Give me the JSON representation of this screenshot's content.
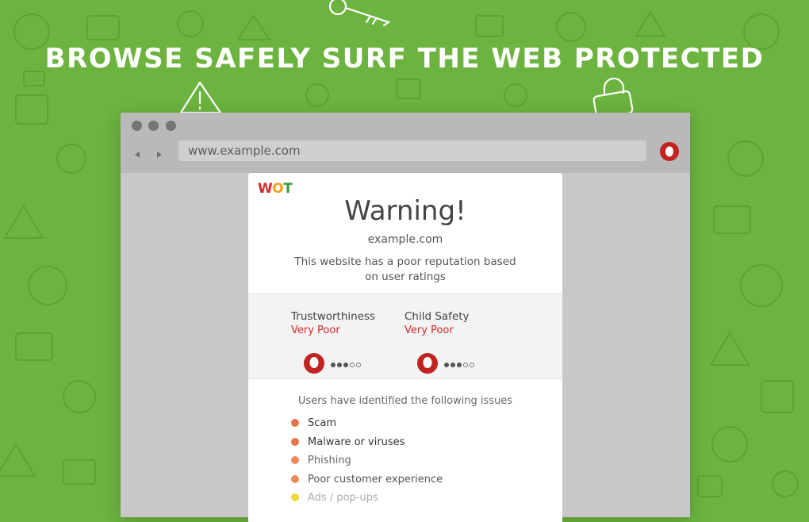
{
  "banner": {
    "headline": "BROWSE SAFELY SURF THE WEB PROTECTED"
  },
  "browser": {
    "address": "www.example.com",
    "nav_back_icon": "triangle-left-icon",
    "nav_forward_icon": "triangle-right-icon",
    "extension_icon": "wot-ring-icon"
  },
  "warning": {
    "logo": {
      "w": "W",
      "o": "O",
      "t": "T"
    },
    "title": "Warning!",
    "domain": "example.com",
    "description": "This website has a poor reputation based on user ratings",
    "ratings": [
      {
        "label": "Trustworthiness",
        "value": "Very Poor",
        "score_dots": 3,
        "max_dots": 5
      },
      {
        "label": "Child Safety",
        "value": "Very Poor",
        "score_dots": 3,
        "max_dots": 5
      }
    ],
    "issues_title": "Users have identified the following issues",
    "issues": [
      {
        "label": "Scam",
        "dot_color": "#e8734a",
        "text_color": "#333333"
      },
      {
        "label": "Malware or viruses",
        "dot_color": "#e8734a",
        "text_color": "#333333"
      },
      {
        "label": "Phishing",
        "dot_color": "#ee8a5a",
        "text_color": "#666666"
      },
      {
        "label": "Poor customer experience",
        "dot_color": "#ee8a5a",
        "text_color": "#555555"
      },
      {
        "label": "Ads / pop-ups",
        "dot_color": "#f2d83b",
        "text_color": "#aaaaaa"
      }
    ]
  },
  "colors": {
    "background": "#6cb33f",
    "accent_red": "#d52a2a",
    "logo_w": "#d52a2a",
    "logo_o": "#f0a01a",
    "logo_t": "#3a9a3a"
  }
}
